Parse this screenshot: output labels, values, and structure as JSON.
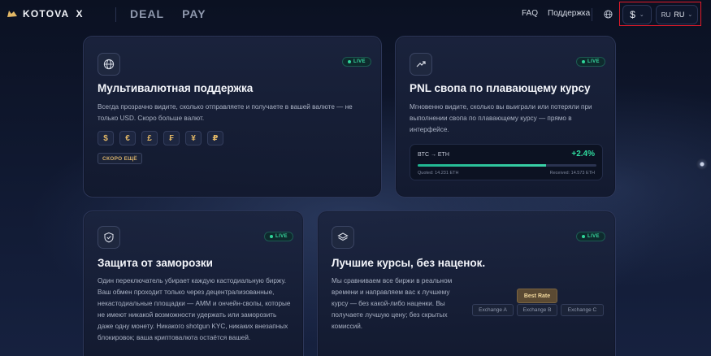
{
  "brand": {
    "name": "KOTOVA",
    "suffix": "X"
  },
  "nav_main": [
    "DEAL",
    "PAY"
  ],
  "nav_right": [
    "FAQ",
    "Поддержка"
  ],
  "currency_selector": {
    "symbol": "$"
  },
  "language_selector": {
    "code": "RU",
    "name": "RU"
  },
  "colors": {
    "accent_gold": "#e3b866",
    "live_green": "#2fd59a",
    "highlight_red": "#e11a2a"
  },
  "cards": {
    "multicurrency": {
      "icon": "globe-icon",
      "badge": "LIVE",
      "title": "Мультивалютная поддержка",
      "description": "Всегда прозрачно видите, сколько отправляете и получаете в вашей валюте — не только USD. Скоро больше валют.",
      "currencies": [
        "$",
        "€",
        "£",
        "₣",
        "¥",
        "₽"
      ],
      "soon_label": "СКОРО ЕЩЁ"
    },
    "pnl": {
      "icon": "trend-up-icon",
      "badge": "LIVE",
      "title": "PNL свопа по плавающему курсу",
      "description": "Мгновенно видите, сколько вы выиграли или потеряли при выполнении свопа по плавающему курсу — прямо в интерфейсе.",
      "swap": {
        "pair": "BTC → ETH",
        "change": "+2.4%",
        "progress": 0.72,
        "quoted": "Quoted: 14.231 ETH",
        "received": "Received: 14.573 ETH"
      }
    },
    "freeze": {
      "icon": "shield-check-icon",
      "badge": "LIVE",
      "title": "Защита от заморозки",
      "description": "Один переключатель убирает каждую кастодиальную биржу. Ваш обмен проходит только через децентрализованные, некастодиальные площадки — AMM и ончейн-свопы, которые не имеют никакой возможности удержать или заморозить даже одну монету. Никакого shotgun KYC, никаких внезапных блокировок; ваша криптовалюта остаётся вашей."
    },
    "rates": {
      "icon": "layers-icon",
      "badge": "LIVE",
      "title": "Лучшие курсы, без наценок.",
      "description": "Мы сравниваем все биржи в реальном времени и направляем вас к лучшему курсу — без какой-либо наценки. Вы получаете лучшую цену; без скрытых комиссий.",
      "best_label": "Best Rate",
      "exchanges": [
        "Exchange A",
        "Exchange B",
        "Exchange C"
      ]
    }
  }
}
